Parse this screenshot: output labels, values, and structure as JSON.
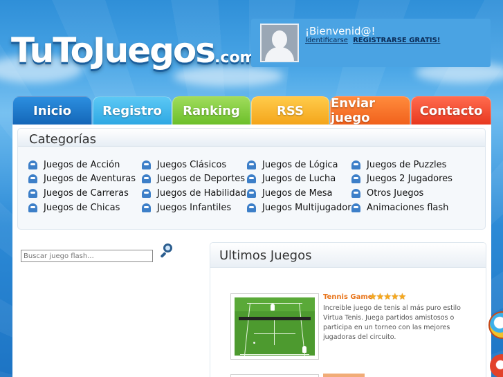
{
  "header": {
    "logo_main": "TuToJuegos",
    "logo_domain": ".com"
  },
  "welcome": {
    "title": "¡Bienvenid@!",
    "login_link": "Identificarse",
    "register_link": "REGISTRARSE GRATIS!"
  },
  "nav": {
    "tabs": [
      {
        "label": "Inicio"
      },
      {
        "label": "Registro"
      },
      {
        "label": "Ranking"
      },
      {
        "label": "RSS"
      },
      {
        "label": "Enviar juego"
      },
      {
        "label": "Contacto"
      }
    ]
  },
  "categories": {
    "title": "Categorías",
    "columns": [
      [
        "Juegos de Acción",
        "Juegos de Aventuras",
        "Juegos de Carreras",
        "Juegos de Chicas"
      ],
      [
        "Juegos Clásicos",
        "Juegos de Deportes",
        "Juegos de Habilidad",
        "Juegos Infantiles"
      ],
      [
        "Juegos de Lógica",
        "Juegos de Lucha",
        "Juegos de Mesa",
        "Juegos Multijugador"
      ],
      [
        "Juegos de Puzzles",
        "Juegos 2 Jugadores",
        "Otros Juegos",
        "Animaciones flash"
      ]
    ],
    "icon": "ghost-icon"
  },
  "search": {
    "placeholder": "Buscar juego flash...",
    "icon": "magnifier-icon"
  },
  "latest": {
    "title": "Ultimos Juegos",
    "games": [
      {
        "title": "Tennis Game",
        "rating": 5,
        "rating_max": 5,
        "description": "Increible juego de tenis al más puro estilo Virtua Tenis. Juega partidos amistosos o participa en un torneo con las mejores jugadoras del circuito."
      }
    ]
  },
  "colors": {
    "accent_orange": "#e8751c",
    "star_gold": "#f6a81c",
    "tab_inicio": "#1466b8",
    "tab_registro": "#2ea8e3",
    "tab_ranking": "#6cbf2a",
    "tab_rss": "#f4a51b",
    "tab_enviar": "#f1611c",
    "tab_contacto": "#e8381f"
  }
}
